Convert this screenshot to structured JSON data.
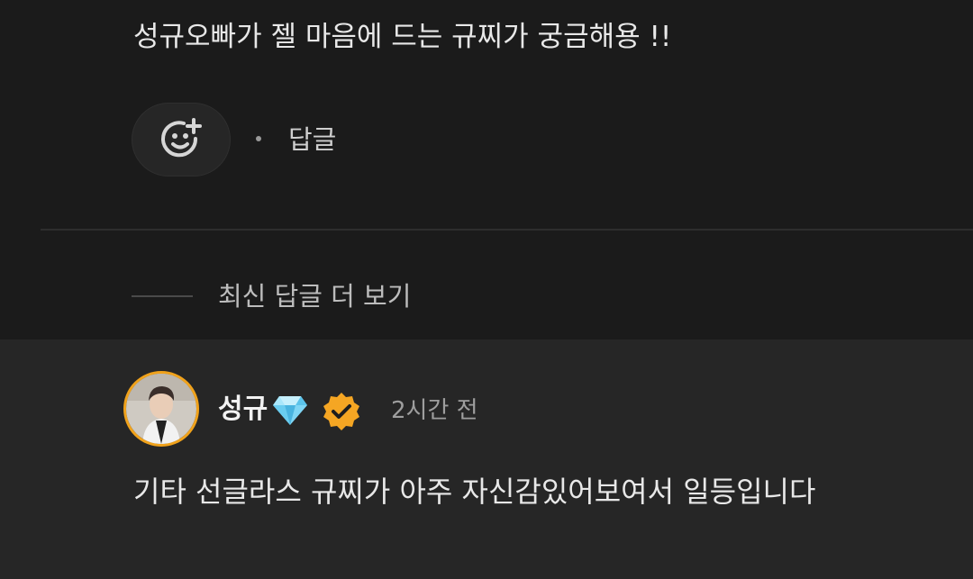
{
  "comment": {
    "text": "성규오빠가 젤 마음에 드는 규찌가 궁금해용 !!",
    "reaction_icon": "add-emoji-icon",
    "reply_label": "답글"
  },
  "more_replies": {
    "label": "최신 답글 더 보기"
  },
  "reply": {
    "author": "성규",
    "author_badge_icon": "gem-icon",
    "verified_icon": "verified-check-icon",
    "timestamp": "2시간 전",
    "text": "기타 선글라스 규찌가 아주 자신감있어보여서 일등입니다"
  },
  "colors": {
    "background": "#1b1b1b",
    "reply_background": "#262626",
    "avatar_ring": "#f0a21b",
    "verified_badge": "#f5a623"
  }
}
